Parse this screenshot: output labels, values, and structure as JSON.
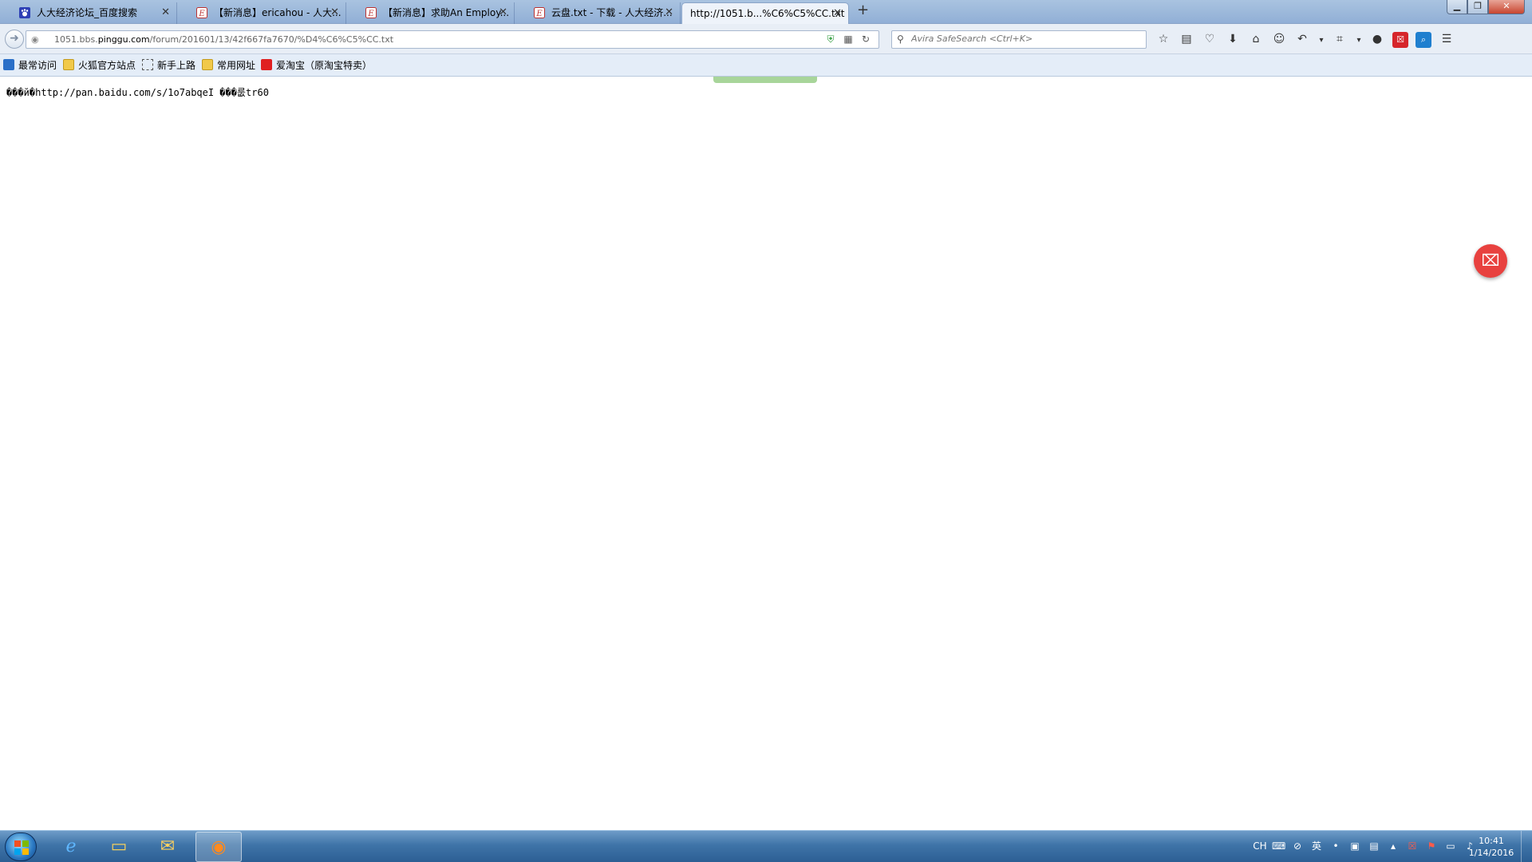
{
  "tabs": [
    {
      "title": "人大经济论坛_百度搜索",
      "icon": "baidu-paw-icon",
      "active": false
    },
    {
      "title": "【新消息】ericahou - 人大...",
      "icon": "pinggu-e-icon",
      "active": false
    },
    {
      "title": "【新消息】求助An Employ...",
      "icon": "pinggu-e-icon",
      "active": false
    },
    {
      "title": "云盘.txt - 下载 - 人大经济...",
      "icon": "pinggu-e-icon",
      "active": false
    },
    {
      "title": "http://1051.b...%C6%C5%CC.txt",
      "icon": "none",
      "active": true
    }
  ],
  "navbar": {
    "url_prefix": "1051.bbs.",
    "url_domain": "pinggu.com",
    "url_path": "/forum/201601/13/42f667fa7670/%D4%C6%C5%CC.txt",
    "search_placeholder": "Avira SafeSearch <Ctrl+K>"
  },
  "bookmarks": [
    {
      "label": "最常访问",
      "icon": "most-visited-icon"
    },
    {
      "label": "火狐官方站点",
      "icon": "folder-icon"
    },
    {
      "label": "新手上路",
      "icon": "page-icon"
    },
    {
      "label": "常用网址",
      "icon": "folder-icon"
    },
    {
      "label": "爱淘宝（原淘宝特卖）",
      "icon": "taobao-icon"
    }
  ],
  "page": {
    "content": "���й�http://pan.baidu.com/s/1o7abqeI ���룺tr60"
  },
  "taskbar": {
    "apps": [
      "start-orb",
      "internet-explorer",
      "windows-explorer",
      "outlook",
      "firefox"
    ],
    "language": "CH",
    "time": "10:41",
    "date": "1/14/2016"
  },
  "colors": {
    "accent_red": "#e8413f",
    "taskbar_blue": "#3f74a8"
  }
}
